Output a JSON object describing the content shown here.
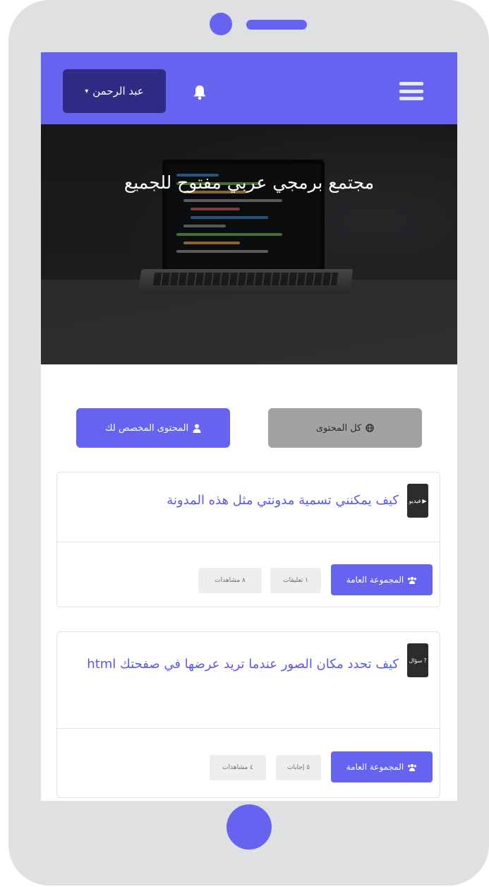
{
  "navbar": {
    "user_name": "عبد الرحمن",
    "user_caret": "▾",
    "menu_icon": "hamburger-icon",
    "notification_icon": "bell-icon"
  },
  "hero": {
    "title": "مجتمع برمجي عربي مفتوح للجميع"
  },
  "filters": {
    "all_content": "كل المحتوى",
    "custom_content": "المحتوى المخصص لك"
  },
  "posts": [
    {
      "type_label": "فيديو",
      "type_icon": "play-icon",
      "title": "كيف يمكنني تسمية مدونتي مثل هذه المدونة",
      "group": "المجموعة العامة",
      "stat_1": "١ تعليقات",
      "stat_2": "٨ مشاهدات"
    },
    {
      "type_label": "سؤال",
      "type_icon": "question-icon",
      "title": "كيف تحدد مكان الصور عندما تريد عرضها في صفحتك html",
      "group": "المجموعة العامة",
      "stat_1": "٥ إجابات",
      "stat_2": "٤ مشاهدات"
    }
  ],
  "colors": {
    "accent": "#6563f0",
    "accent_dark": "#2f2c86",
    "device_frame": "#dfe0e2",
    "badge_dark": "#2c2c2e"
  }
}
